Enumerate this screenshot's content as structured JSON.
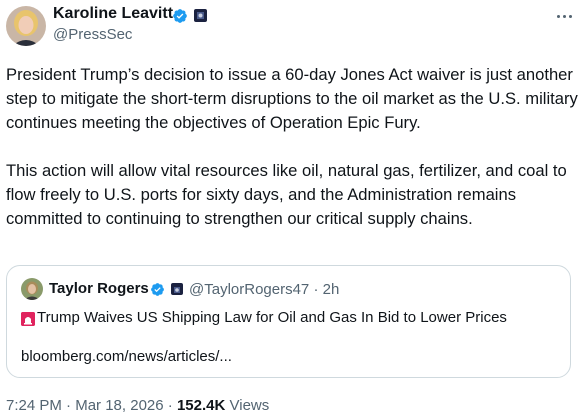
{
  "author": {
    "name": "Karoline Leavitt",
    "handle": "@PressSec"
  },
  "tweet": {
    "paragraph1": "President Trump’s decision to issue a 60-day Jones Act waiver is just another step to mitigate the short-term disruptions to the oil market as the U.S. military continues meeting the objectives of Operation Epic Fury.",
    "paragraph2": "This action will allow vital resources like oil, natural gas, fertilizer, and coal to flow freely to U.S. ports for sixty days, and the Administration remains committed to continuing to strengthen our critical supply chains."
  },
  "quote": {
    "name": "Taylor Rogers",
    "handle": "@TaylorRogers47",
    "separator": "·",
    "time": "2h",
    "headline": "Trump Waives US Shipping Law for Oil and Gas In Bid to Lower Prices",
    "link": "bloomberg.com/news/articles/..."
  },
  "footer": {
    "time": "7:24 PM",
    "separator": "·",
    "date": "Mar 18, 2026",
    "views_count": "152.4K",
    "views_label": "Views"
  },
  "icons": {
    "verified": "verified-badge-icon",
    "affiliate": "government-affiliate-icon",
    "more": "more-options-icon",
    "siren": "siren-emoji-icon"
  },
  "colors": {
    "verified_blue": "#1d9bf0",
    "text": "#0f1419",
    "secondary": "#536471",
    "border": "#cfd9de"
  }
}
